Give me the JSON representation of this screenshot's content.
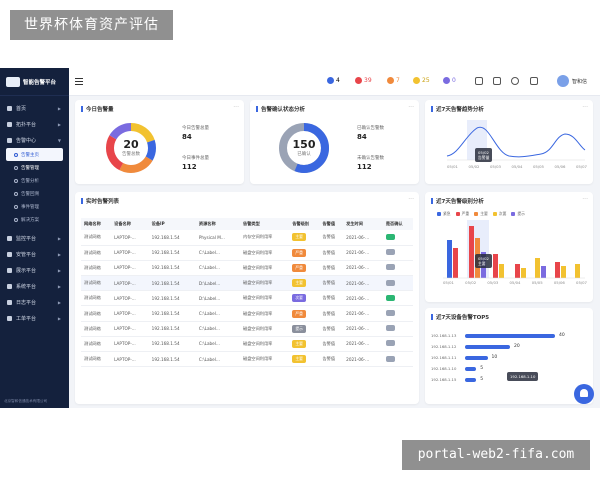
{
  "watermarks": {
    "top_left": "世界杯体育资产评估",
    "bottom_right": "portal-web2-fifa.com"
  },
  "app": {
    "logo_title": "智能告警平台"
  },
  "sidebar": {
    "items": [
      {
        "label": "首页"
      },
      {
        "label": "拓扑平台"
      },
      {
        "label": "告警中心"
      }
    ],
    "sub_items": [
      {
        "label": "告警主页"
      },
      {
        "label": "告警管理"
      },
      {
        "label": "告警分析"
      },
      {
        "label": "告警回溯"
      },
      {
        "label": "事件管理"
      },
      {
        "label": "解决方案"
      }
    ],
    "items2": [
      {
        "label": "监控平台"
      },
      {
        "label": "安管平台"
      },
      {
        "label": "展示平台"
      },
      {
        "label": "系统平台"
      },
      {
        "label": "日志平台"
      },
      {
        "label": "工单平台"
      }
    ],
    "copyright": "北京智和信通技术有限公司"
  },
  "topbar": {
    "stats": [
      {
        "value": "4",
        "color": "#3a67e0"
      },
      {
        "value": "39",
        "color": "#e8454a"
      },
      {
        "value": "7",
        "color": "#f08a3c"
      },
      {
        "value": "25",
        "color": "#f2c230"
      },
      {
        "value": "0",
        "color": "#7a6be0"
      }
    ],
    "user_name": "智和信"
  },
  "today_alarm": {
    "title": "今日告警量",
    "total": "20",
    "total_label": "告警总数",
    "today_total_label": "今日告警总量",
    "today_total": "84",
    "today_events_label": "今日事件总量",
    "today_events": "112"
  },
  "confirm_status": {
    "title": "告警确认状态分析",
    "center_value": "150",
    "center_label": "已确认",
    "confirmed_label": "已确认告警数",
    "confirmed": "84",
    "unconfirmed_label": "未确认告警数",
    "unconfirmed": "112"
  },
  "trend": {
    "title": "近7天告警趋势分析",
    "tooltip_date": "05/02",
    "tooltip_label": "告警量",
    "dates": [
      "05/01",
      "05/02",
      "05/03",
      "05/04",
      "05/05",
      "05/06",
      "05/07"
    ]
  },
  "level_dist": {
    "title": "近7天告警级别分析",
    "legend": [
      "紧急",
      "严重",
      "主要",
      "次要",
      "提示"
    ],
    "legend_colors": [
      "#3a67e0",
      "#e8454a",
      "#f08a3c",
      "#f2c230",
      "#7a6be0"
    ],
    "tooltip_date": "05/02",
    "tooltip_label": "主要",
    "dates": [
      "05/01",
      "05/02",
      "05/03",
      "05/04",
      "05/05",
      "05/06",
      "05/07"
    ]
  },
  "device_top5": {
    "title": "近7天设备告警TOP5",
    "rows": [
      {
        "ip": "192.168.1.13",
        "value": 40
      },
      {
        "ip": "192.168.1.12",
        "value": 20
      },
      {
        "ip": "192.168.1.11",
        "value": 10
      },
      {
        "ip": "192.168.1.10",
        "value": 5
      },
      {
        "ip": "192.168.1.15",
        "value": 5
      }
    ],
    "tooltip_ip": "192.168.1.10"
  },
  "alarm_list": {
    "title": "实时告警列表",
    "headers": [
      "网络名称",
      "设备名称",
      "设备IP",
      "资源名称",
      "告警类型",
      "告警级别",
      "告警值",
      "发生时间",
      "是否确认"
    ],
    "rows": [
      {
        "net": "测试网络",
        "dev": "LAPTOP-...",
        "ip": "192.168.1.54",
        "res": "Physical M...",
        "type": "内存空间利用率",
        "level": "主要",
        "lc": "#f2c230",
        "val": "告警值",
        "time": "2021-06-...",
        "ack": "#2bb673"
      },
      {
        "net": "测试网络",
        "dev": "LAPTOP-...",
        "ip": "192.168.1.54",
        "res": "C:\\Label...",
        "type": "磁盘空间利用率",
        "level": "严重",
        "lc": "#f08a3c",
        "val": "告警值",
        "time": "2021-06-...",
        "ack": "#9aa3b5"
      },
      {
        "net": "测试网络",
        "dev": "LAPTOP-...",
        "ip": "192.168.1.54",
        "res": "C:\\Label...",
        "type": "磁盘空间利用率",
        "level": "严重",
        "lc": "#f08a3c",
        "val": "告警值",
        "time": "2021-06-...",
        "ack": "#9aa3b5"
      },
      {
        "net": "测试网络",
        "dev": "LAPTOP-...",
        "ip": "192.168.1.54",
        "res": "D:\\Label...",
        "type": "磁盘空间利用率",
        "level": "主要",
        "lc": "#f2c230",
        "val": "告警值",
        "time": "2021-06-...",
        "ack": "#9aa3b5"
      },
      {
        "net": "测试网络",
        "dev": "LAPTOP-...",
        "ip": "192.168.1.54",
        "res": "D:\\Label...",
        "type": "磁盘空间利用率",
        "level": "次要",
        "lc": "#7a6be0",
        "val": "告警值",
        "time": "2021-06-...",
        "ack": "#2bb673"
      },
      {
        "net": "测试网络",
        "dev": "LAPTOP-...",
        "ip": "192.168.1.54",
        "res": "C:\\Label...",
        "type": "磁盘空间利用率",
        "level": "严重",
        "lc": "#f08a3c",
        "val": "告警值",
        "time": "2021-06-...",
        "ack": "#9aa3b5"
      },
      {
        "net": "测试网络",
        "dev": "LAPTOP-...",
        "ip": "192.168.1.54",
        "res": "C:\\Label...",
        "type": "磁盘空间利用率",
        "level": "提示",
        "lc": "#8a8f9c",
        "val": "告警值",
        "time": "2021-06-...",
        "ack": "#9aa3b5"
      },
      {
        "net": "测试网络",
        "dev": "LAPTOP-...",
        "ip": "192.168.1.54",
        "res": "C:\\Label...",
        "type": "磁盘空间利用率",
        "level": "主要",
        "lc": "#f2c230",
        "val": "告警值",
        "time": "2021-06-...",
        "ack": "#9aa3b5"
      },
      {
        "net": "测试网络",
        "dev": "LAPTOP-...",
        "ip": "192.168.1.54",
        "res": "C:\\Label...",
        "type": "磁盘空间利用率",
        "level": "主要",
        "lc": "#f2c230",
        "val": "告警值",
        "time": "2021-06-...",
        "ack": "#9aa3b5"
      }
    ]
  }
}
